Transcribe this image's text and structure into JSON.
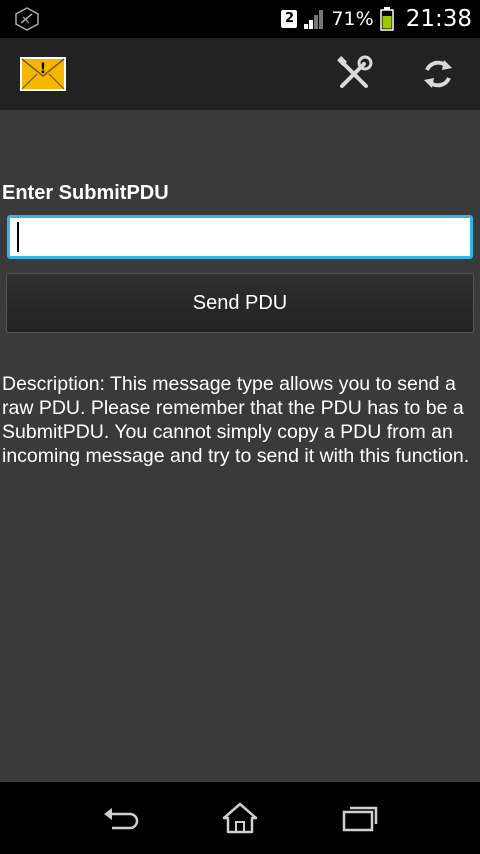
{
  "status_bar": {
    "sim_slot": "2",
    "battery_percent": "71%",
    "time": "21:38",
    "icons": [
      "app-notification-icon",
      "sim-icon",
      "signal-icon",
      "battery-icon"
    ]
  },
  "action_bar": {
    "app_icon": "mail-alert-icon",
    "actions": [
      "tools-icon",
      "refresh-icon"
    ]
  },
  "form": {
    "label": "Enter SubmitPDU",
    "input_value": "",
    "input_placeholder": "",
    "send_label": "Send PDU"
  },
  "description": "Description: This message type allows you to send a raw PDU. Please remember that the PDU has to be a SubmitPDU. You cannot simply copy a PDU from an incoming message and try to send it with this function.",
  "nav_bar": {
    "buttons": [
      "back-icon",
      "home-icon",
      "recent-apps-icon"
    ]
  },
  "colors": {
    "accent": "#33b5e5",
    "background": "#3a3a3a",
    "action_bar": "#222222",
    "battery": "#99cc00",
    "mail_icon": "#f5b700"
  }
}
